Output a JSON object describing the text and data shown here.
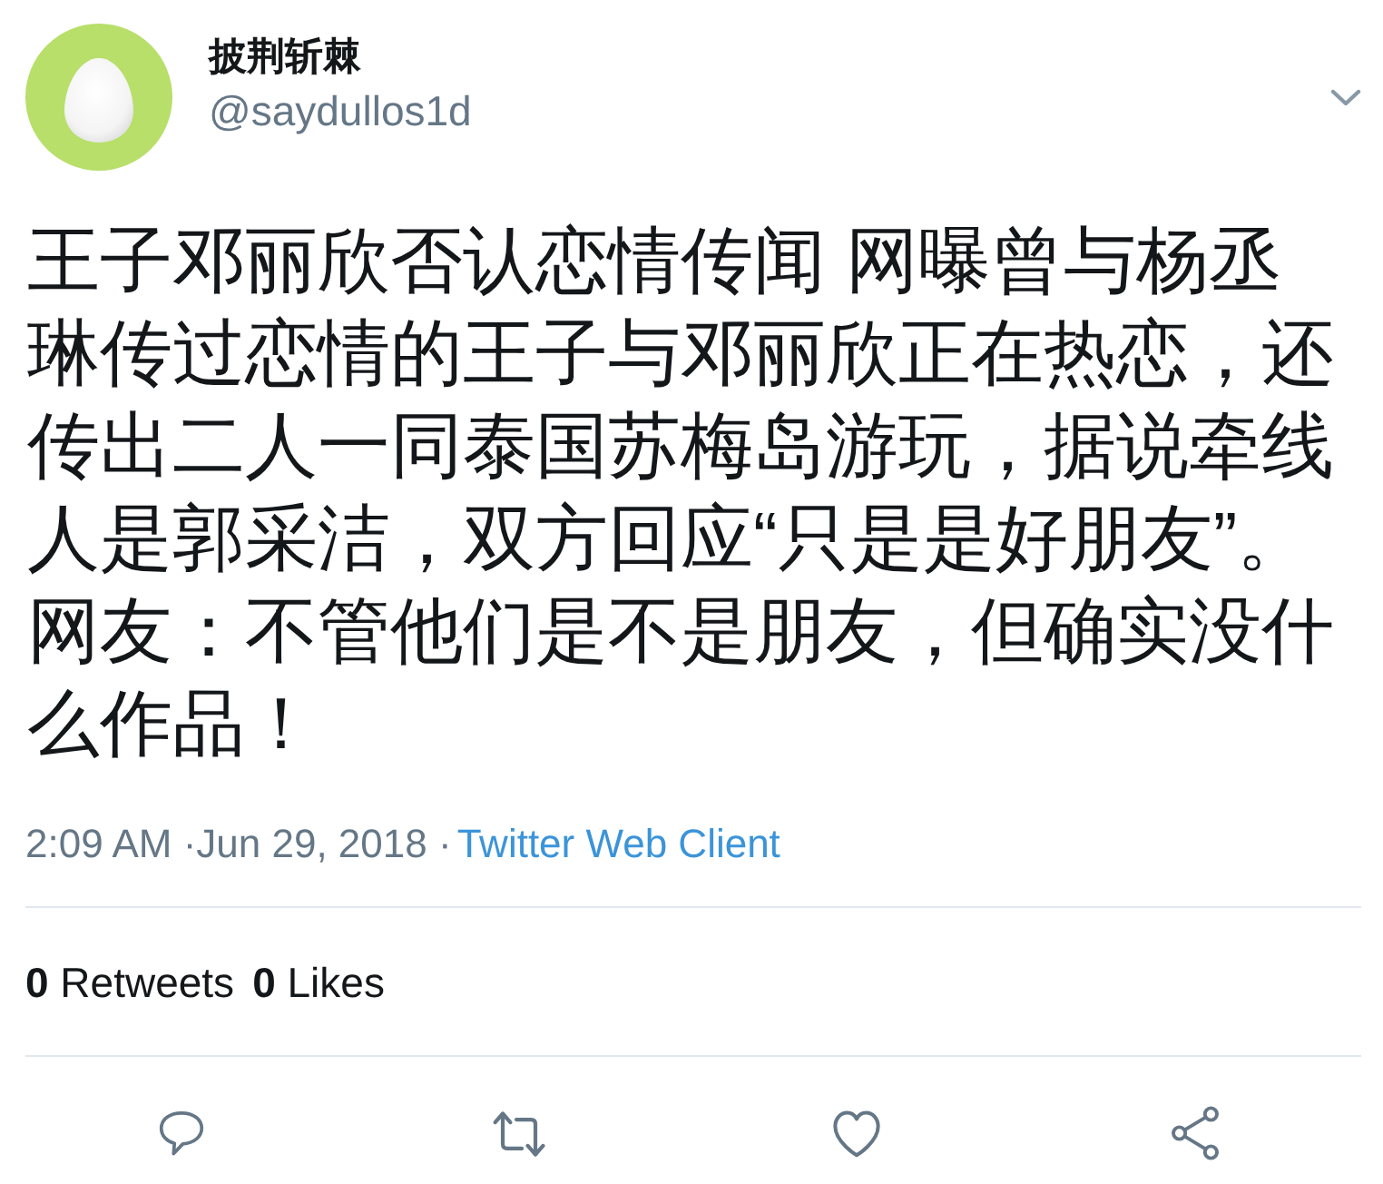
{
  "author": {
    "name": "披荆斩棘",
    "handle": "@saydullos1d"
  },
  "tweet": {
    "text": "王子邓丽欣否认恋情传闻 网曝曾与杨丞琳传过恋情的王子与邓丽欣正在热恋，还传出二人一同泰国苏梅岛游玩，据说牵线人是郭采洁，双方回应“只是是好朋友”。网友：不管他们是不是朋友，但确实没什么作品！",
    "timestamp": "2:09 AM ·Jun 29, 2018 ·",
    "source": "Twitter Web Client"
  },
  "stats": [
    {
      "count": "0",
      "label": "Retweets"
    },
    {
      "count": "0",
      "label": "Likes"
    }
  ]
}
